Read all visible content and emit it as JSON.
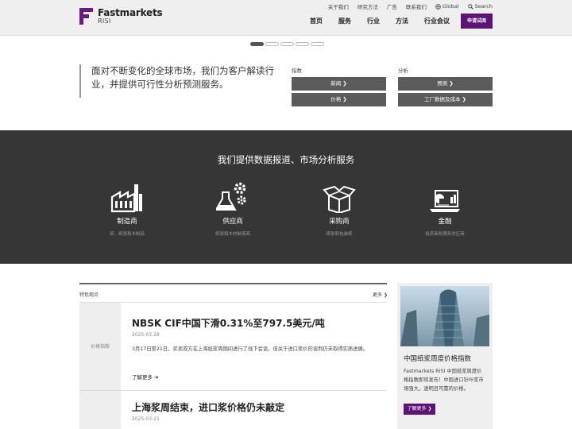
{
  "brand": {
    "name": "Fastmarkets",
    "sub": "RISI",
    "color": "#5b1472"
  },
  "utility": {
    "about": "关于我们",
    "research": "研究方法",
    "ads": "广告",
    "contact": "联系我们",
    "global": "Global",
    "search": "Search"
  },
  "nav": {
    "home": "首页",
    "services": "服务",
    "industry": "行业",
    "methods": "方法",
    "conferences": "行业会议",
    "trial": "申请试阅"
  },
  "slider": {
    "count": 5,
    "active": 1
  },
  "hero": {
    "quote": "面对不断变化的全球市场，我们为客户解读行业，并提供可行性分析预测服务。",
    "index": {
      "label": "指数",
      "news": "新闻 ❯",
      "prices": "价格 ❯"
    },
    "analysis": {
      "label": "分析",
      "forecast": "预测 ❯",
      "mill": "工厂数据及成本 ❯"
    }
  },
  "services": {
    "title": "我们提供数据报道、市场分析服务",
    "items": [
      {
        "name": "制造商",
        "desc": "浆、纸张和木制品"
      },
      {
        "name": "供应商",
        "desc": "纸张和木材制造商"
      },
      {
        "name": "采购商",
        "desc": "纸张和包装纸"
      },
      {
        "name": "金融",
        "desc": "投资商和服务供应商"
      }
    ]
  },
  "featured": {
    "heading": "特色观点",
    "more": "更多 ❯",
    "articles": [
      {
        "category": "价格指数",
        "title": "NBSK CIF中国下滑0.31%至797.5美元/吨",
        "date": "2025-03-28",
        "summary": "3月17日至21日，买卖双方在上海纸浆周期间进行了线下会谈，但关于进口浆价的谈判仍未取得实质进展。",
        "readmore": "了解更多 ➔"
      },
      {
        "category": "",
        "title": "上海浆周结束，进口浆价格仍未敲定",
        "date": "2025-03-21",
        "summary": "",
        "readmore": ""
      }
    ]
  },
  "card": {
    "title": "中国纸浆周度价格指数",
    "text": "Fastmarkets RISI 中国纸浆周度价格指数即将发布！中国进口针叶浆市场强大，透明且可靠的价格。",
    "button": "了解更多 ❯"
  }
}
